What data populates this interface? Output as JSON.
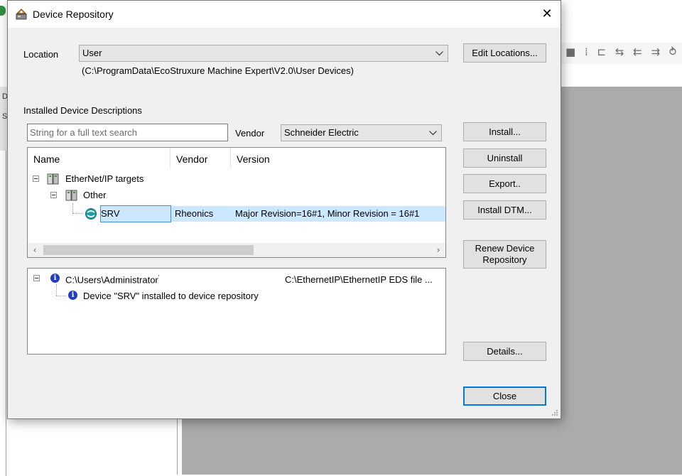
{
  "background": {
    "toolbar_icons": "■ ⁞ ⊏ ⇆ ⇇ ⇉ ⥁",
    "left_tabs": [
      "D",
      "S"
    ]
  },
  "dialog": {
    "title": "Device Repository",
    "close_glyph": "✕",
    "location": {
      "label": "Location",
      "selected": "User",
      "path": "(C:\\ProgramData\\EcoStruxure Machine Expert\\V2.0\\User Devices)",
      "edit_button": "Edit Locations..."
    },
    "installed": {
      "section_label": "Installed Device Descriptions",
      "search_placeholder": "String for a full text search",
      "vendor_label": "Vendor",
      "vendor_selected": "Schneider Electric",
      "columns": [
        "Name",
        "Vendor",
        "Version"
      ],
      "tree": {
        "root": "EtherNet/IP targets",
        "group": "Other",
        "device": {
          "name": "SRV",
          "vendor": "Rheonics",
          "version": "Major Revision=16#1, Minor Revision = 16#1"
        }
      }
    },
    "messages": {
      "source": "C:\\Users\\Administrator",
      "source_marker": "'",
      "file": "C:\\EthernetIP\\EthernetIP EDS file ...",
      "detail": "Device \"SRV\" installed to device repository"
    },
    "buttons": {
      "install": "Install...",
      "uninstall": "Uninstall",
      "export": "Export..",
      "install_dtm": "Install DTM...",
      "renew_line1": "Renew Device",
      "renew_line2": "Repository",
      "details": "Details...",
      "close": "Close"
    },
    "colors": {
      "selection": "#cce8ff",
      "default_button_border": "#0078d7",
      "info_icon": "#1f3fbf"
    }
  }
}
